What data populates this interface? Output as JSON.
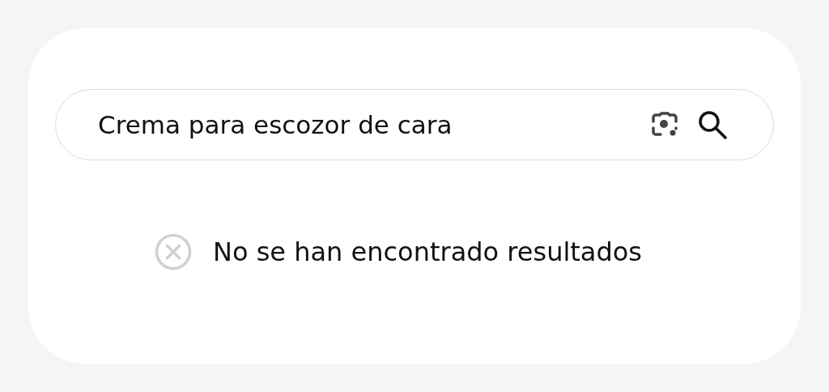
{
  "search": {
    "value": "Crema para escozor de cara"
  },
  "message": {
    "text": "No se han encontrado resultados"
  }
}
